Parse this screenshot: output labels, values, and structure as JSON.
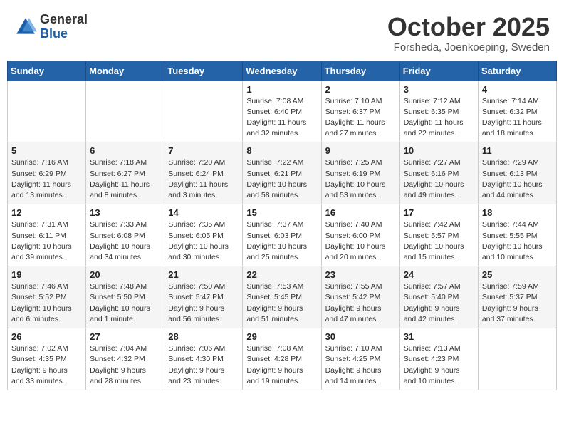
{
  "header": {
    "logo_general": "General",
    "logo_blue": "Blue",
    "month": "October 2025",
    "location": "Forsheda, Joenkoeping, Sweden"
  },
  "weekdays": [
    "Sunday",
    "Monday",
    "Tuesday",
    "Wednesday",
    "Thursday",
    "Friday",
    "Saturday"
  ],
  "weeks": [
    [
      {
        "day": "",
        "info": ""
      },
      {
        "day": "",
        "info": ""
      },
      {
        "day": "",
        "info": ""
      },
      {
        "day": "1",
        "info": "Sunrise: 7:08 AM\nSunset: 6:40 PM\nDaylight: 11 hours\nand 32 minutes."
      },
      {
        "day": "2",
        "info": "Sunrise: 7:10 AM\nSunset: 6:37 PM\nDaylight: 11 hours\nand 27 minutes."
      },
      {
        "day": "3",
        "info": "Sunrise: 7:12 AM\nSunset: 6:35 PM\nDaylight: 11 hours\nand 22 minutes."
      },
      {
        "day": "4",
        "info": "Sunrise: 7:14 AM\nSunset: 6:32 PM\nDaylight: 11 hours\nand 18 minutes."
      }
    ],
    [
      {
        "day": "5",
        "info": "Sunrise: 7:16 AM\nSunset: 6:29 PM\nDaylight: 11 hours\nand 13 minutes."
      },
      {
        "day": "6",
        "info": "Sunrise: 7:18 AM\nSunset: 6:27 PM\nDaylight: 11 hours\nand 8 minutes."
      },
      {
        "day": "7",
        "info": "Sunrise: 7:20 AM\nSunset: 6:24 PM\nDaylight: 11 hours\nand 3 minutes."
      },
      {
        "day": "8",
        "info": "Sunrise: 7:22 AM\nSunset: 6:21 PM\nDaylight: 10 hours\nand 58 minutes."
      },
      {
        "day": "9",
        "info": "Sunrise: 7:25 AM\nSunset: 6:19 PM\nDaylight: 10 hours\nand 53 minutes."
      },
      {
        "day": "10",
        "info": "Sunrise: 7:27 AM\nSunset: 6:16 PM\nDaylight: 10 hours\nand 49 minutes."
      },
      {
        "day": "11",
        "info": "Sunrise: 7:29 AM\nSunset: 6:13 PM\nDaylight: 10 hours\nand 44 minutes."
      }
    ],
    [
      {
        "day": "12",
        "info": "Sunrise: 7:31 AM\nSunset: 6:11 PM\nDaylight: 10 hours\nand 39 minutes."
      },
      {
        "day": "13",
        "info": "Sunrise: 7:33 AM\nSunset: 6:08 PM\nDaylight: 10 hours\nand 34 minutes."
      },
      {
        "day": "14",
        "info": "Sunrise: 7:35 AM\nSunset: 6:05 PM\nDaylight: 10 hours\nand 30 minutes."
      },
      {
        "day": "15",
        "info": "Sunrise: 7:37 AM\nSunset: 6:03 PM\nDaylight: 10 hours\nand 25 minutes."
      },
      {
        "day": "16",
        "info": "Sunrise: 7:40 AM\nSunset: 6:00 PM\nDaylight: 10 hours\nand 20 minutes."
      },
      {
        "day": "17",
        "info": "Sunrise: 7:42 AM\nSunset: 5:57 PM\nDaylight: 10 hours\nand 15 minutes."
      },
      {
        "day": "18",
        "info": "Sunrise: 7:44 AM\nSunset: 5:55 PM\nDaylight: 10 hours\nand 10 minutes."
      }
    ],
    [
      {
        "day": "19",
        "info": "Sunrise: 7:46 AM\nSunset: 5:52 PM\nDaylight: 10 hours\nand 6 minutes."
      },
      {
        "day": "20",
        "info": "Sunrise: 7:48 AM\nSunset: 5:50 PM\nDaylight: 10 hours\nand 1 minute."
      },
      {
        "day": "21",
        "info": "Sunrise: 7:50 AM\nSunset: 5:47 PM\nDaylight: 9 hours\nand 56 minutes."
      },
      {
        "day": "22",
        "info": "Sunrise: 7:53 AM\nSunset: 5:45 PM\nDaylight: 9 hours\nand 51 minutes."
      },
      {
        "day": "23",
        "info": "Sunrise: 7:55 AM\nSunset: 5:42 PM\nDaylight: 9 hours\nand 47 minutes."
      },
      {
        "day": "24",
        "info": "Sunrise: 7:57 AM\nSunset: 5:40 PM\nDaylight: 9 hours\nand 42 minutes."
      },
      {
        "day": "25",
        "info": "Sunrise: 7:59 AM\nSunset: 5:37 PM\nDaylight: 9 hours\nand 37 minutes."
      }
    ],
    [
      {
        "day": "26",
        "info": "Sunrise: 7:02 AM\nSunset: 4:35 PM\nDaylight: 9 hours\nand 33 minutes."
      },
      {
        "day": "27",
        "info": "Sunrise: 7:04 AM\nSunset: 4:32 PM\nDaylight: 9 hours\nand 28 minutes."
      },
      {
        "day": "28",
        "info": "Sunrise: 7:06 AM\nSunset: 4:30 PM\nDaylight: 9 hours\nand 23 minutes."
      },
      {
        "day": "29",
        "info": "Sunrise: 7:08 AM\nSunset: 4:28 PM\nDaylight: 9 hours\nand 19 minutes."
      },
      {
        "day": "30",
        "info": "Sunrise: 7:10 AM\nSunset: 4:25 PM\nDaylight: 9 hours\nand 14 minutes."
      },
      {
        "day": "31",
        "info": "Sunrise: 7:13 AM\nSunset: 4:23 PM\nDaylight: 9 hours\nand 10 minutes."
      },
      {
        "day": "",
        "info": ""
      }
    ]
  ]
}
